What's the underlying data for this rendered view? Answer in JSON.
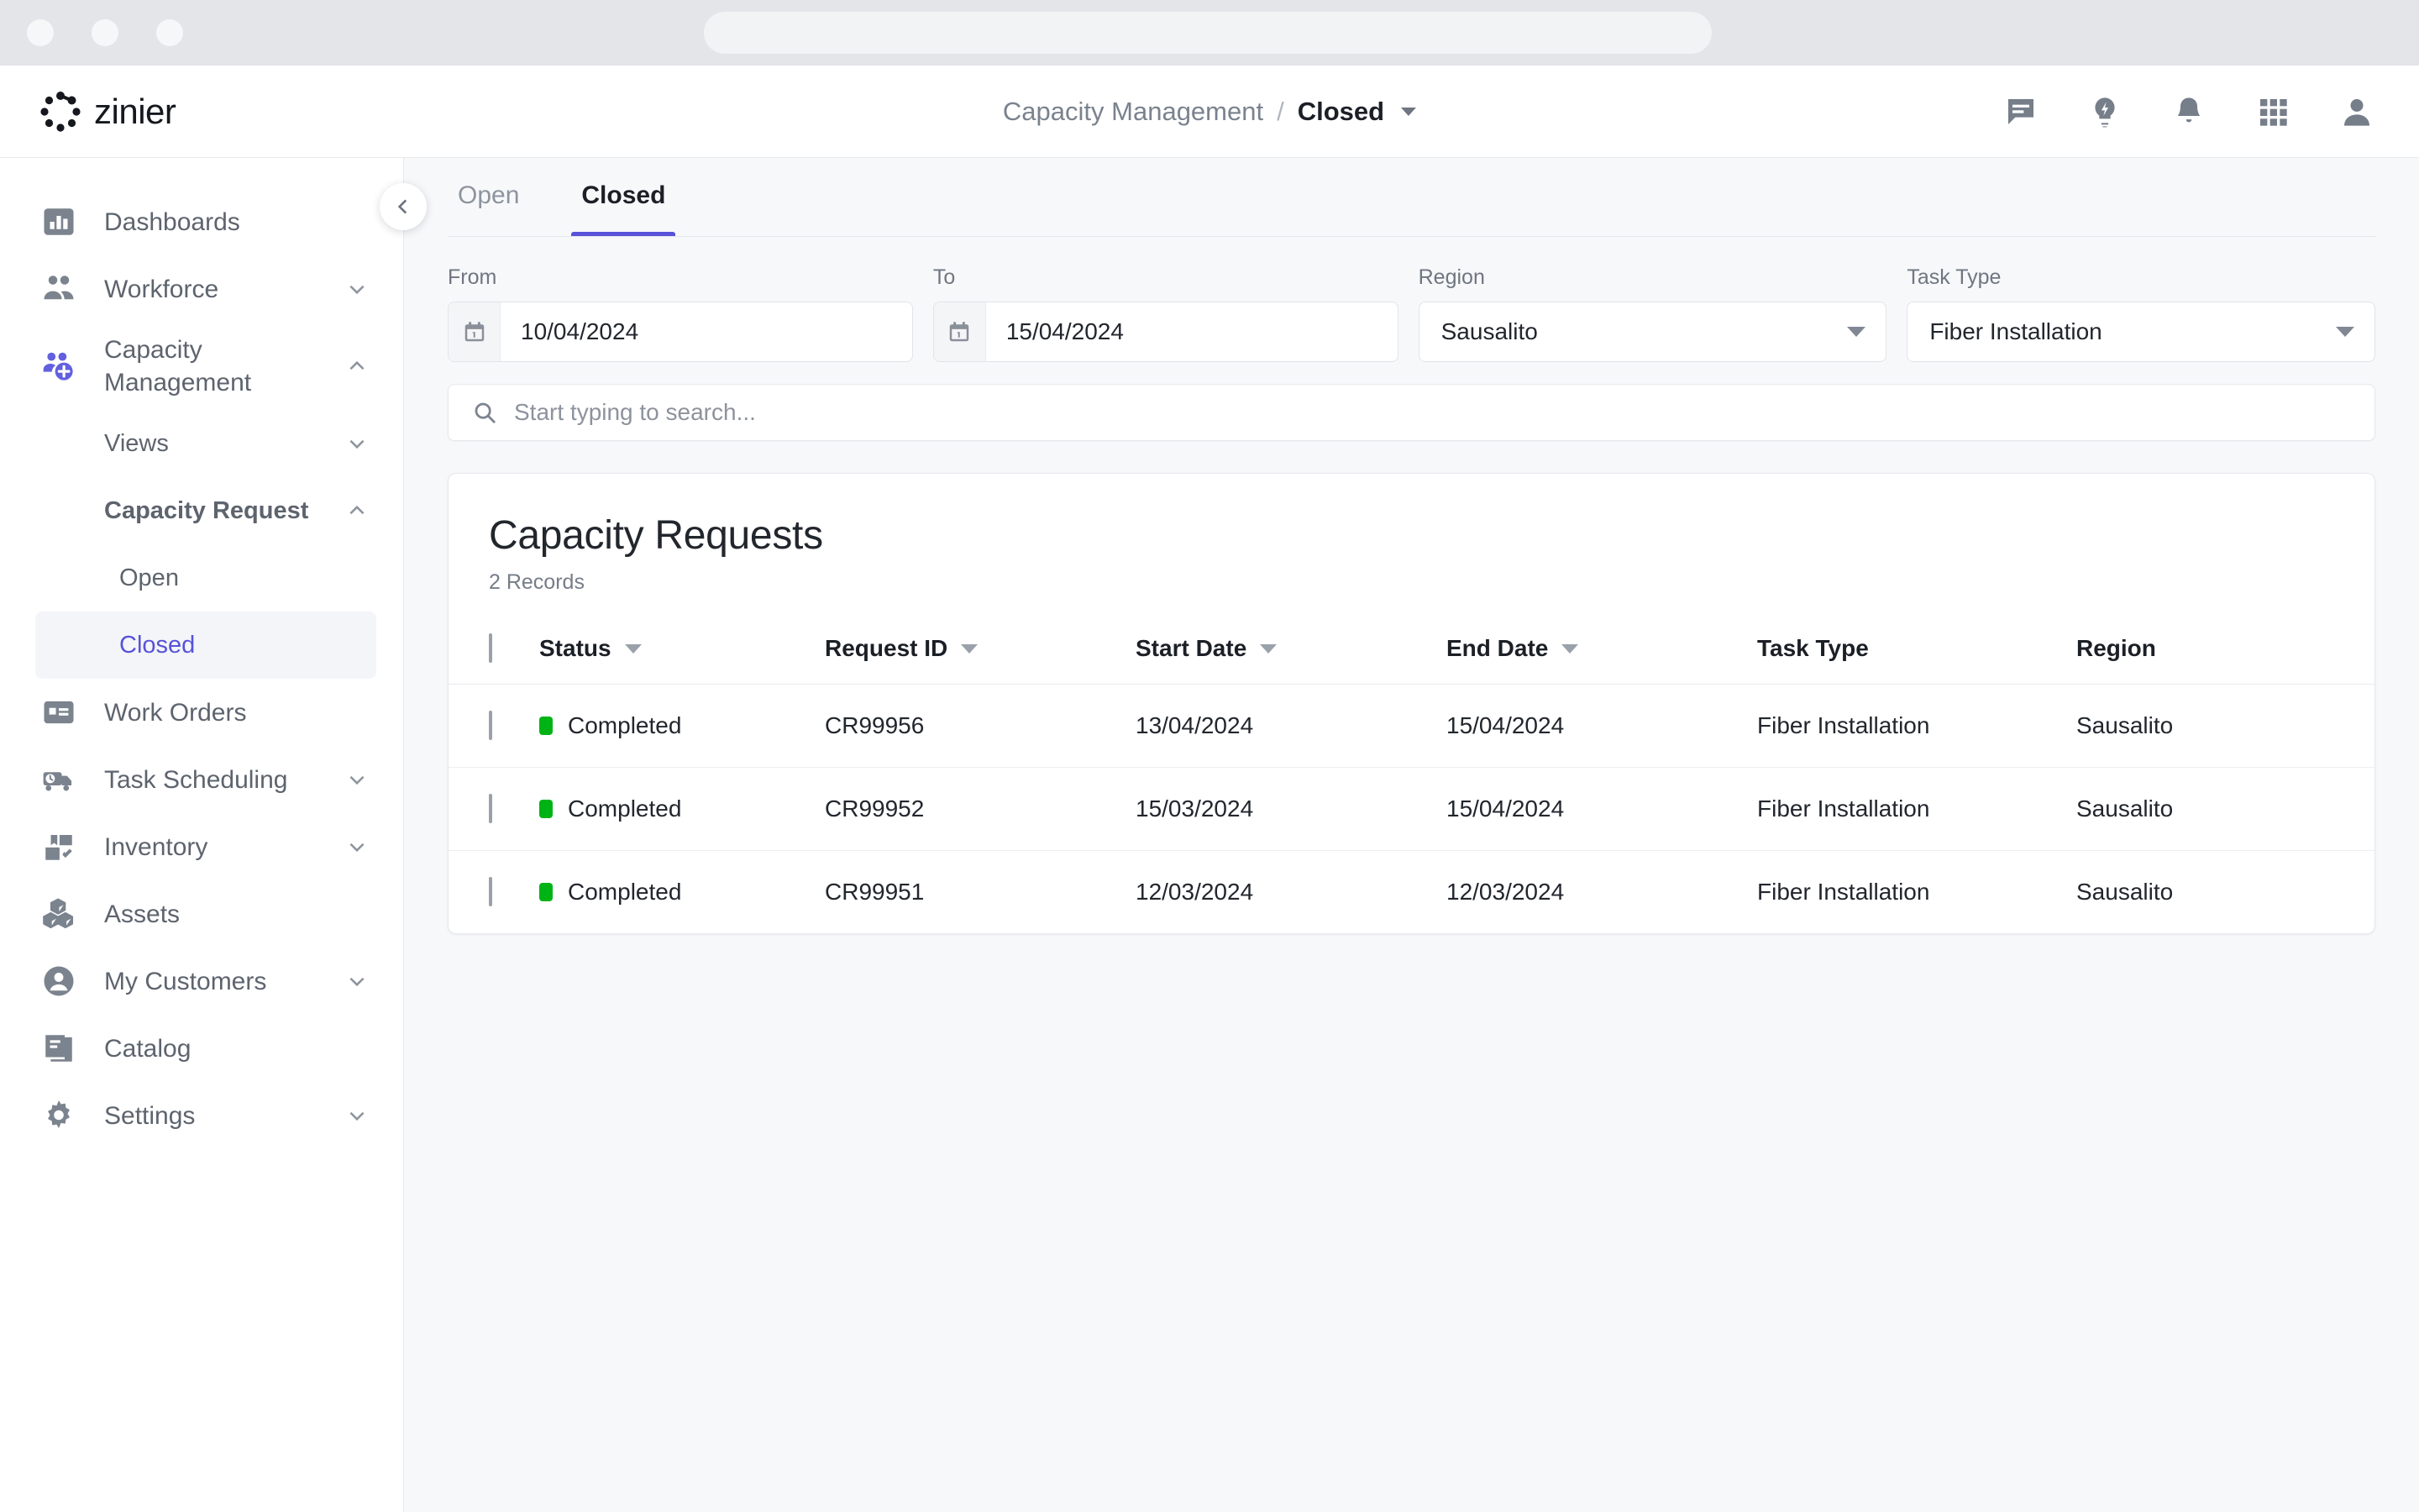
{
  "browser": {
    "traffic_lights": [
      "close",
      "minimize",
      "maximize"
    ],
    "omnibox_value": ""
  },
  "appbar": {
    "logo_text": "zinier",
    "breadcrumb": {
      "parent": "Capacity Management",
      "separator": "/",
      "current": "Closed"
    },
    "actions": [
      {
        "name": "chat-icon",
        "label": "Chat"
      },
      {
        "name": "lightbulb-icon",
        "label": "Insights"
      },
      {
        "name": "bell-icon",
        "label": "Notifications"
      },
      {
        "name": "apps-grid-icon",
        "label": "Apps"
      },
      {
        "name": "user-avatar-icon",
        "label": "Profile"
      }
    ]
  },
  "sidebar": {
    "collapse_label": "Collapse sidebar",
    "items": [
      {
        "label": "Dashboards",
        "icon": "dashboard-icon",
        "active": false,
        "chevron": "none"
      },
      {
        "label": "Workforce",
        "icon": "workforce-icon",
        "active": false,
        "chevron": "down"
      },
      {
        "label": "Capacity Management",
        "icon": "capacity-management-icon",
        "active": true,
        "chevron": "up"
      }
    ],
    "sub_items": [
      {
        "label": "Views",
        "chevron": "down",
        "semibold": false
      },
      {
        "label": "Capacity Request",
        "chevron": "up",
        "semibold": true
      }
    ],
    "leaf_items": [
      {
        "label": "Open",
        "active": false
      },
      {
        "label": "Closed",
        "active": true
      }
    ],
    "items_lower": [
      {
        "label": "Work Orders",
        "icon": "work-orders-icon",
        "chevron": "none"
      },
      {
        "label": "Task Scheduling",
        "icon": "task-scheduling-icon",
        "chevron": "down"
      },
      {
        "label": "Inventory",
        "icon": "inventory-icon",
        "chevron": "down"
      },
      {
        "label": "Assets",
        "icon": "assets-icon",
        "chevron": "none"
      },
      {
        "label": "My Customers",
        "icon": "my-customers-icon",
        "chevron": "down"
      },
      {
        "label": "Catalog",
        "icon": "catalog-icon",
        "chevron": "none"
      },
      {
        "label": "Settings",
        "icon": "settings-icon",
        "chevron": "down"
      }
    ]
  },
  "main": {
    "tabs": [
      {
        "label": "Open",
        "active": false
      },
      {
        "label": "Closed",
        "active": true
      }
    ],
    "filters": {
      "from": {
        "label": "From",
        "value": "10/04/2024"
      },
      "to": {
        "label": "To",
        "value": "15/04/2024"
      },
      "region": {
        "label": "Region",
        "value": "Sausalito"
      },
      "task_type": {
        "label": "Task Type",
        "value": "Fiber Installation"
      }
    },
    "search": {
      "placeholder": "Start typing to search...",
      "value": ""
    },
    "table": {
      "title": "Capacity Requests",
      "record_count": "2 Records",
      "columns": [
        {
          "label": "Status",
          "sortable": true
        },
        {
          "label": "Request ID",
          "sortable": true
        },
        {
          "label": "Start Date",
          "sortable": true
        },
        {
          "label": "End Date",
          "sortable": true
        },
        {
          "label": "Task Type",
          "sortable": false
        },
        {
          "label": "Region",
          "sortable": false
        }
      ],
      "rows": [
        {
          "status": "Completed",
          "status_color": "#00b315",
          "request_id": "CR99956",
          "start_date": "13/04/2024",
          "end_date": "15/04/2024",
          "task_type": "Fiber Installation",
          "region": "Sausalito"
        },
        {
          "status": "Completed",
          "status_color": "#00b315",
          "request_id": "CR99952",
          "start_date": "15/03/2024",
          "end_date": "15/04/2024",
          "task_type": "Fiber Installation",
          "region": "Sausalito"
        },
        {
          "status": "Completed",
          "status_color": "#00b315",
          "request_id": "CR99951",
          "start_date": "12/03/2024",
          "end_date": "12/03/2024",
          "task_type": "Fiber Installation",
          "region": "Sausalito"
        }
      ]
    }
  },
  "colors": {
    "accent": "#5752d8",
    "accent_icon": "#6360e0",
    "status_green": "#00b315",
    "page_bg": "#f7f8fa",
    "text_primary": "#22262d",
    "text_muted": "#7a828e"
  }
}
